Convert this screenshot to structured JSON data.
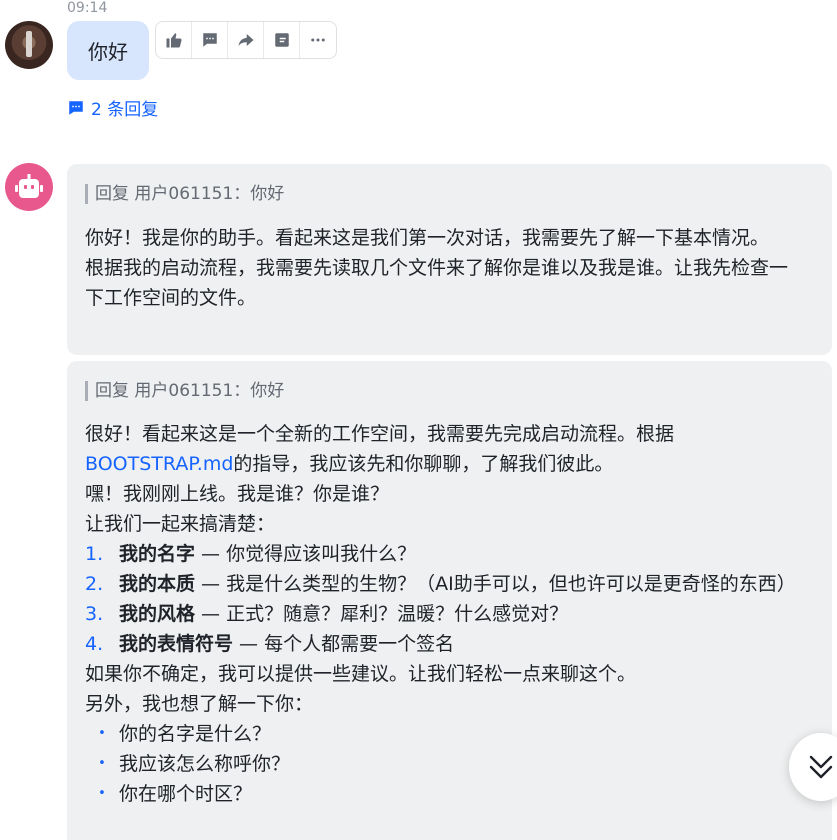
{
  "user_message": {
    "time": "09:14",
    "text": "你好",
    "reply_count_label": "2 条回复"
  },
  "toolbar": {
    "icons": [
      "thumbs-up-icon",
      "comment-icon",
      "forward-icon",
      "pin-icon",
      "more-icon"
    ]
  },
  "replies": [
    {
      "quote": "回复 用户061151：你好",
      "paragraphs": [
        "你好！我是你的助手。看起来这是我们第一次对话，我需要先了解一下基本情况。",
        "根据我的启动流程，我需要先读取几个文件来了解你是谁以及我是谁。让我先检查一下工作空间的文件。"
      ]
    },
    {
      "quote": "回复 用户061151：你好",
      "intro_before_link": "很好！看起来这是一个全新的工作空间，我需要先完成启动流程。根据",
      "link": "BOOTSTRAP.md",
      "intro_after_link": "的指导，我应该先和你聊聊，了解我们彼此。",
      "line2": "嘿！我刚刚上线。我是谁？你是谁？",
      "line3": "让我们一起来搞清楚：",
      "ordered_list": [
        {
          "num": "1.",
          "bold": "我的名字",
          "rest": " — 你觉得应该叫我什么？"
        },
        {
          "num": "2.",
          "bold": "我的本质",
          "rest": " — 我是什么类型的生物？（AI助手可以，但也许可以是更奇怪的东西）"
        },
        {
          "num": "3.",
          "bold": "我的风格",
          "rest": " — 正式？随意？犀利？温暖？什么感觉对？"
        },
        {
          "num": "4.",
          "bold": "我的表情符号",
          "rest": " — 每个人都需要一个签名"
        }
      ],
      "line4": "如果你不确定，我可以提供一些建议。让我们轻松一点来聊这个。",
      "line5": "另外，我也想了解一下你：",
      "bullets": [
        "你的名字是什么？",
        "我应该怎么称呼你？",
        "你在哪个时区？"
      ]
    }
  ],
  "colors": {
    "accent": "#1664ff",
    "user_bubble": "#d7e6fd",
    "card_bg": "#eff0f1",
    "bot_avatar": "#e8588d"
  }
}
